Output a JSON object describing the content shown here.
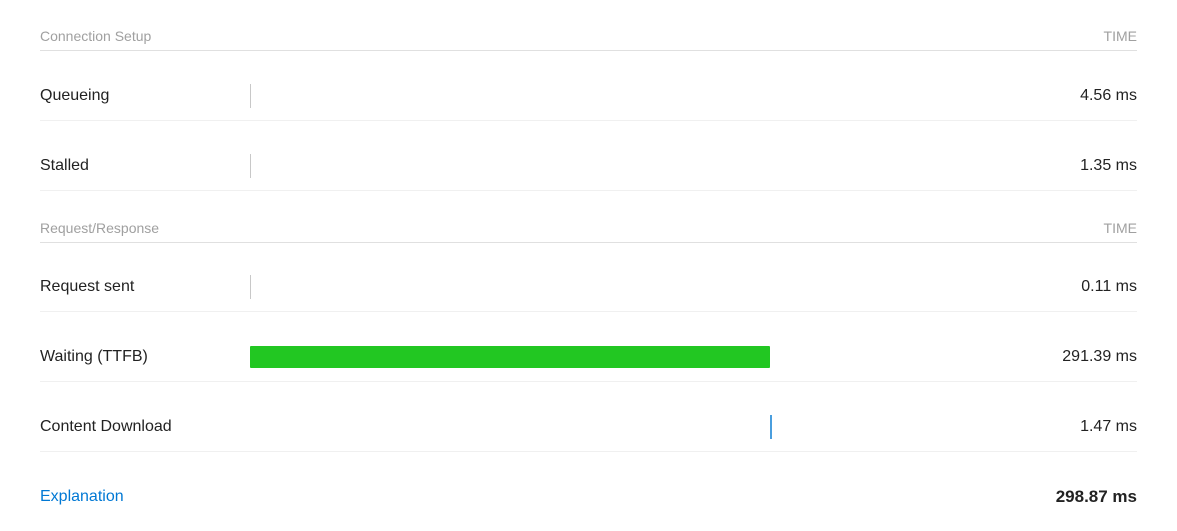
{
  "connectionSetup": {
    "sectionLabel": "Connection Setup",
    "timeLabel": "TIME",
    "rows": [
      {
        "label": "Queueing",
        "time": "4.56 ms",
        "barType": "tick"
      },
      {
        "label": "Stalled",
        "time": "1.35 ms",
        "barType": "tick"
      }
    ]
  },
  "requestResponse": {
    "sectionLabel": "Request/Response",
    "timeLabel": "TIME",
    "rows": [
      {
        "label": "Request sent",
        "time": "0.11 ms",
        "barType": "tick"
      },
      {
        "label": "Waiting (TTFB)",
        "time": "291.39 ms",
        "barType": "green"
      },
      {
        "label": "Content Download",
        "time": "1.47 ms",
        "barType": "blue-tick"
      }
    ]
  },
  "footer": {
    "explanationLabel": "Explanation",
    "totalTime": "298.87 ms"
  }
}
